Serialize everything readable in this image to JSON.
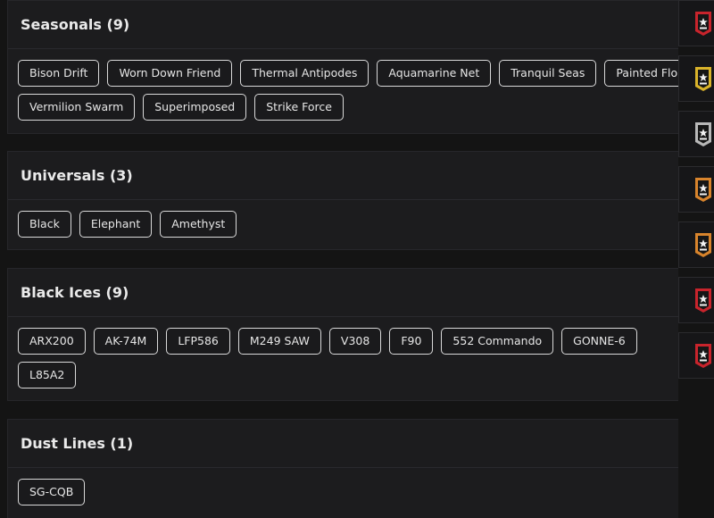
{
  "sections": [
    {
      "title": "Seasonals (9)",
      "tags": [
        "Bison Drift",
        "Worn Down Friend",
        "Thermal Antipodes",
        "Aquamarine Net",
        "Tranquil Seas",
        "Painted Flora",
        "Vermilion Swarm",
        "Superimposed",
        "Strike Force"
      ]
    },
    {
      "title": "Universals (3)",
      "tags": [
        "Black",
        "Elephant",
        "Amethyst"
      ]
    },
    {
      "title": "Black Ices (9)",
      "tags": [
        "ARX200",
        "AK-74M",
        "LFP586",
        "M249 SAW",
        "V308",
        "F90",
        "552 Commando",
        "GONNE-6",
        "L85A2"
      ]
    },
    {
      "title": "Dust Lines (1)",
      "tags": [
        "SG-CQB"
      ]
    }
  ],
  "badges": [
    {
      "name": "red-badge-icon",
      "color": "#c8242c"
    },
    {
      "name": "gold-badge-icon",
      "color": "#d9b32a"
    },
    {
      "name": "silver-badge-icon",
      "color": "#b8b8b8"
    },
    {
      "name": "orange-badge-icon",
      "color": "#d8842c"
    },
    {
      "name": "orange-badge-icon",
      "color": "#d8842c"
    },
    {
      "name": "red-badge-icon",
      "color": "#c8242c"
    },
    {
      "name": "red-badge-icon",
      "color": "#c8242c"
    }
  ]
}
